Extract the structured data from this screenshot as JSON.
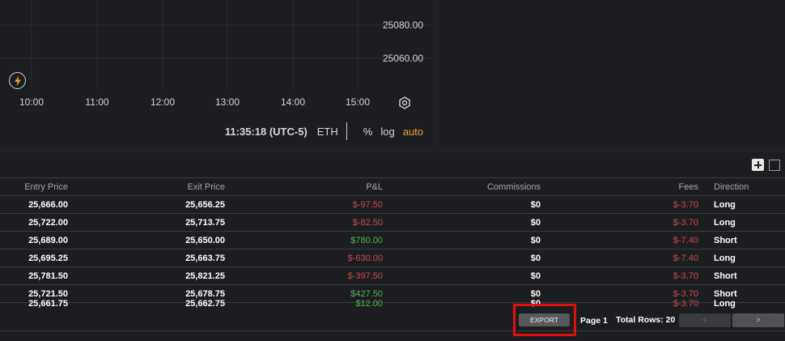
{
  "chart": {
    "price_labels": [
      "25080.00",
      "25060.00"
    ],
    "time_ticks": [
      "10:00",
      "11:00",
      "12:00",
      "13:00",
      "14:00",
      "15:00"
    ],
    "clock": "11:35:18 (UTC-5)",
    "symbol": "ETH",
    "scale_options": {
      "percent": "%",
      "log": "log",
      "auto": "auto"
    },
    "active_option": "auto",
    "icons": {
      "quick_trade": "lightning-icon",
      "settings": "gear-icon"
    }
  },
  "table": {
    "columns": {
      "entry_price": "Entry Price",
      "exit_price": "Exit Price",
      "pnl": "P&L",
      "commissions": "Commissions",
      "fees": "Fees",
      "direction": "Direction"
    },
    "rows": [
      {
        "entry": "25,666.00",
        "exit": "25,656.25",
        "pnl": "$-97.50",
        "pnl_sign": "neg",
        "comm": "$0",
        "fees": "$-3.70",
        "dir": "Long"
      },
      {
        "entry": "25,722.00",
        "exit": "25,713.75",
        "pnl": "$-82.50",
        "pnl_sign": "neg",
        "comm": "$0",
        "fees": "$-3.70",
        "dir": "Long"
      },
      {
        "entry": "25,689.00",
        "exit": "25,650.00",
        "pnl": "$780.00",
        "pnl_sign": "pos",
        "comm": "$0",
        "fees": "$-7.40",
        "dir": "Short"
      },
      {
        "entry": "25,695.25",
        "exit": "25,663.75",
        "pnl": "$-630.00",
        "pnl_sign": "neg",
        "comm": "$0",
        "fees": "$-7.40",
        "dir": "Long"
      },
      {
        "entry": "25,781.50",
        "exit": "25,821.25",
        "pnl": "$-397.50",
        "pnl_sign": "neg",
        "comm": "$0",
        "fees": "$-3.70",
        "dir": "Short"
      },
      {
        "entry": "25,721.50",
        "exit": "25,678.75",
        "pnl": "$427.50",
        "pnl_sign": "pos",
        "comm": "$0",
        "fees": "$-3.70",
        "dir": "Short"
      },
      {
        "entry": "25,661.75",
        "exit": "25,662.75",
        "pnl": "$12.00",
        "pnl_sign": "pos",
        "comm": "$0",
        "fees": "$-3.70",
        "dir": "Long"
      }
    ]
  },
  "footer": {
    "export_label": "EXPORT",
    "page_label": "Page 1",
    "total_rows_label": "Total Rows: 20",
    "prev_label": "<",
    "next_label": ">"
  },
  "colors": {
    "accent": "#e3a32c",
    "negative": "#c64b4b",
    "positive": "#55b557",
    "highlight": "#e01010"
  }
}
